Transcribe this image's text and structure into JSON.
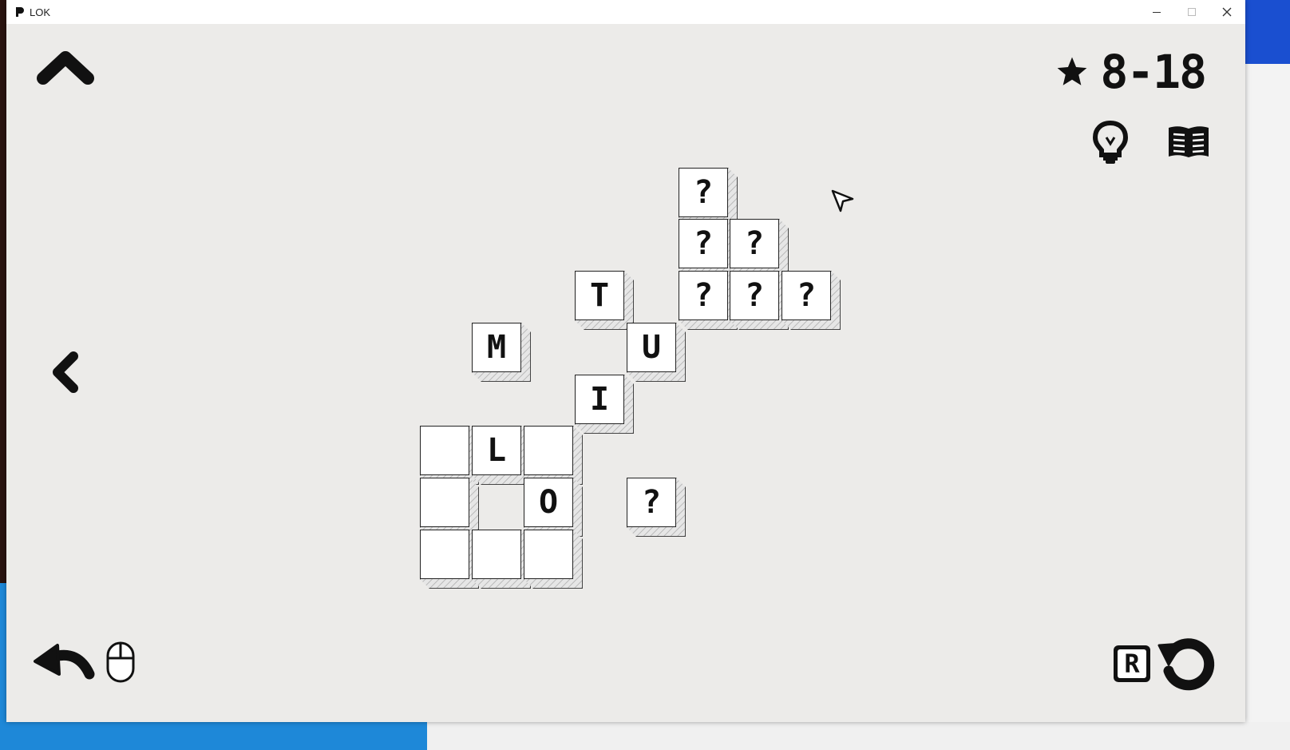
{
  "window": {
    "title": "LOK",
    "controls": {
      "minimize": "minimize",
      "maximize": "maximize",
      "close": "close"
    }
  },
  "hud": {
    "level_label": "8-18",
    "icons": {
      "back": "chevron-up-icon",
      "prev": "chevron-left-icon",
      "star": "star-icon",
      "hint": "lightbulb-icon",
      "book": "book-icon",
      "undo": "undo-arrow-icon",
      "mouse": "mouse-icon",
      "reset_key": "R",
      "reset": "reset-icon"
    }
  },
  "board": {
    "tiles": [
      {
        "id": "q1",
        "letter": "?"
      },
      {
        "id": "q2",
        "letter": "?"
      },
      {
        "id": "q3",
        "letter": "?"
      },
      {
        "id": "q4",
        "letter": "?"
      },
      {
        "id": "q5",
        "letter": "?"
      },
      {
        "id": "q6",
        "letter": "?"
      },
      {
        "id": "t",
        "letter": "T"
      },
      {
        "id": "m",
        "letter": "M"
      },
      {
        "id": "u",
        "letter": "U"
      },
      {
        "id": "i",
        "letter": "I"
      },
      {
        "id": "b1",
        "letter": ""
      },
      {
        "id": "l",
        "letter": "L"
      },
      {
        "id": "b2",
        "letter": ""
      },
      {
        "id": "b3",
        "letter": ""
      },
      {
        "id": "o",
        "letter": "O"
      },
      {
        "id": "q7",
        "letter": "?"
      },
      {
        "id": "b4",
        "letter": ""
      },
      {
        "id": "b5",
        "letter": ""
      },
      {
        "id": "b6",
        "letter": ""
      }
    ]
  },
  "colors": {
    "background": "#ecebe9",
    "ink": "#111111",
    "tile": "#ffffff"
  }
}
